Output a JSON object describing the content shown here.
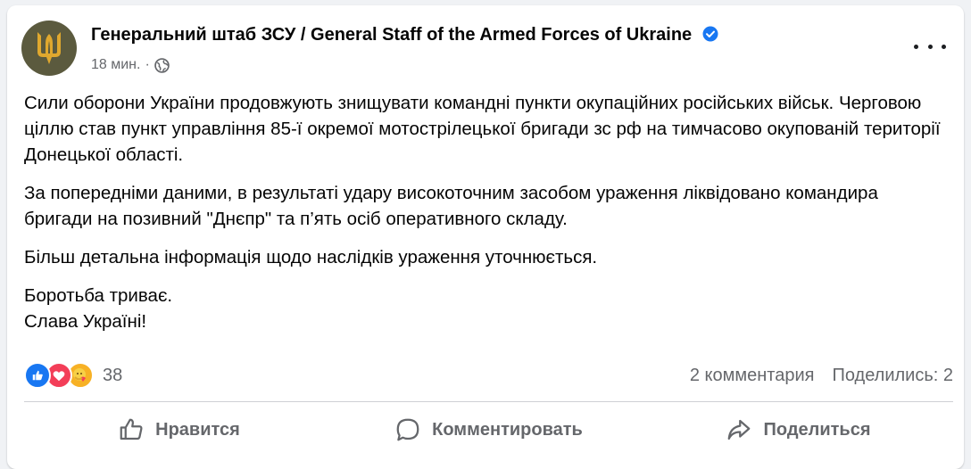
{
  "post": {
    "author": "Генеральний штаб ЗСУ / General Staff of the Armed Forces of Ukraine",
    "time": "18 мин.",
    "separator": "·",
    "paragraphs": [
      "Сили оборони України продовжують знищувати командні пункти окупаційних російських військ. Черговою ціллю став пункт управління 85-ї окремої мотострілецької бригади зс рф на тимчасово окупованій території Донецької області.",
      "За попередніми даними, в результаті удару високоточним засобом ураження ліквідовано командира бригади на позивний \"Днєпр\" та п’ять осіб оперативного складу.",
      "Більш детальна інформація щодо наслідків ураження уточнюється.",
      "Боротьба триває.",
      "Слава Україні!"
    ]
  },
  "reactions": {
    "count": "38",
    "comments": "2 комментария",
    "shares": "Поделились: 2"
  },
  "actions": {
    "like": "Нравится",
    "comment": "Комментировать",
    "share": "Поделиться"
  },
  "colors": {
    "accent": "#1877f2",
    "love": "#f33e58",
    "care": "#f7b125",
    "avatar_bg": "#5b5a3e",
    "emblem": "#e0a82e"
  }
}
